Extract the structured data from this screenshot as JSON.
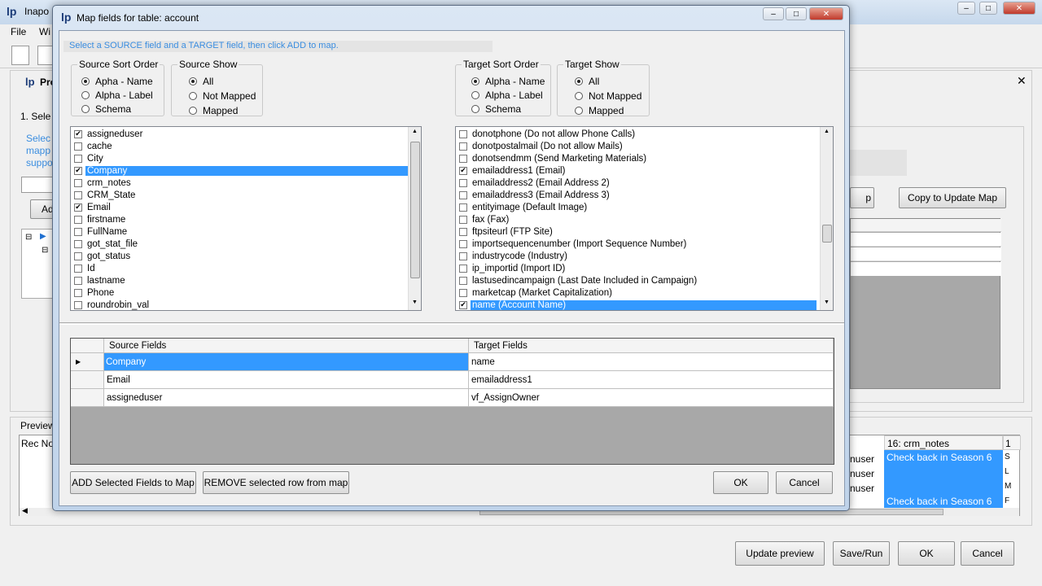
{
  "main_window": {
    "title": "Inapo",
    "menu": [
      "File",
      "Wi"
    ],
    "panel_title": "Pro",
    "step_label": "1. Sele",
    "hint_lines": [
      "Selec",
      "mapp",
      "suppo"
    ],
    "add_label": "Ad",
    "copy_button": "Copy to Update Map",
    "partial_button": "p",
    "preview_label": "Preview",
    "rec_no_header": "Rec No",
    "crm_notes_header": "16: crm_notes",
    "col17_header": "1",
    "user_cells": [
      "nuser",
      "nuser",
      "nuser"
    ],
    "notes_cells": [
      "Check back in Season 6",
      "",
      "",
      "Check back in Season 6"
    ],
    "edge_cells": [
      "S",
      "L",
      "M",
      "F"
    ],
    "buttons": {
      "update_preview": "Update preview",
      "save_run": "Save/Run",
      "ok": "OK",
      "cancel": "Cancel"
    }
  },
  "dialog": {
    "title": "Map fields for table: account",
    "instruction": "Select a SOURCE field and a TARGET field, then click ADD to map.",
    "source_sort": {
      "legend": "Source Sort Order",
      "options": [
        "Apha - Name",
        "Alpha - Label",
        "Schema"
      ],
      "selected": 0
    },
    "source_show": {
      "legend": "Source Show",
      "options": [
        "All",
        "Not Mapped",
        "Mapped"
      ],
      "selected": 0
    },
    "target_sort": {
      "legend": "Target Sort Order",
      "options": [
        "Alpha - Name",
        "Alpha - Label",
        "Schema"
      ],
      "selected": 0
    },
    "target_show": {
      "legend": "Target Show",
      "options": [
        "All",
        "Not Mapped",
        "Mapped"
      ],
      "selected": 0
    },
    "source_fields": [
      {
        "label": "assigneduser",
        "checked": true,
        "selected": false
      },
      {
        "label": "cache",
        "checked": false,
        "selected": false
      },
      {
        "label": "City",
        "checked": false,
        "selected": false
      },
      {
        "label": "Company",
        "checked": true,
        "selected": true
      },
      {
        "label": "crm_notes",
        "checked": false,
        "selected": false
      },
      {
        "label": "CRM_State",
        "checked": false,
        "selected": false
      },
      {
        "label": "Email",
        "checked": true,
        "selected": false
      },
      {
        "label": "firstname",
        "checked": false,
        "selected": false
      },
      {
        "label": "FullName",
        "checked": false,
        "selected": false
      },
      {
        "label": "got_stat_file",
        "checked": false,
        "selected": false
      },
      {
        "label": "got_status",
        "checked": false,
        "selected": false
      },
      {
        "label": "Id",
        "checked": false,
        "selected": false
      },
      {
        "label": "lastname",
        "checked": false,
        "selected": false
      },
      {
        "label": "Phone",
        "checked": false,
        "selected": false
      },
      {
        "label": "roundrobin_val",
        "checked": false,
        "selected": false
      }
    ],
    "target_fields": [
      {
        "label": "donotphone  (Do not allow Phone Calls)",
        "checked": false,
        "selected": false
      },
      {
        "label": "donotpostalmail  (Do not allow Mails)",
        "checked": false,
        "selected": false
      },
      {
        "label": "donotsendmm  (Send Marketing Materials)",
        "checked": false,
        "selected": false
      },
      {
        "label": "emailaddress1  (Email)",
        "checked": true,
        "selected": false
      },
      {
        "label": "emailaddress2  (Email Address 2)",
        "checked": false,
        "selected": false
      },
      {
        "label": "emailaddress3  (Email Address 3)",
        "checked": false,
        "selected": false
      },
      {
        "label": "entityimage  (Default Image)",
        "checked": false,
        "selected": false
      },
      {
        "label": "fax  (Fax)",
        "checked": false,
        "selected": false
      },
      {
        "label": "ftpsiteurl  (FTP Site)",
        "checked": false,
        "selected": false
      },
      {
        "label": "importsequencenumber  (Import Sequence Number)",
        "checked": false,
        "selected": false
      },
      {
        "label": "industrycode  (Industry)",
        "checked": false,
        "selected": false
      },
      {
        "label": "ip_importid  (Import ID)",
        "checked": false,
        "selected": false
      },
      {
        "label": "lastusedincampaign  (Last Date Included in Campaign)",
        "checked": false,
        "selected": false
      },
      {
        "label": "marketcap  (Market Capitalization)",
        "checked": false,
        "selected": false
      },
      {
        "label": "name  (Account Name)",
        "checked": true,
        "selected": true
      }
    ],
    "map_grid": {
      "headers": [
        "Source Fields",
        "Target Fields"
      ],
      "rows": [
        {
          "source": "Company",
          "target": "name",
          "current": true
        },
        {
          "source": "Email",
          "target": "emailaddress1",
          "current": false
        },
        {
          "source": "assigneduser",
          "target": "vf_AssignOwner",
          "current": false
        }
      ]
    },
    "buttons": {
      "add": "ADD Selected Fields to Map",
      "remove": "REMOVE selected row from map",
      "ok": "OK",
      "cancel": "Cancel"
    }
  }
}
